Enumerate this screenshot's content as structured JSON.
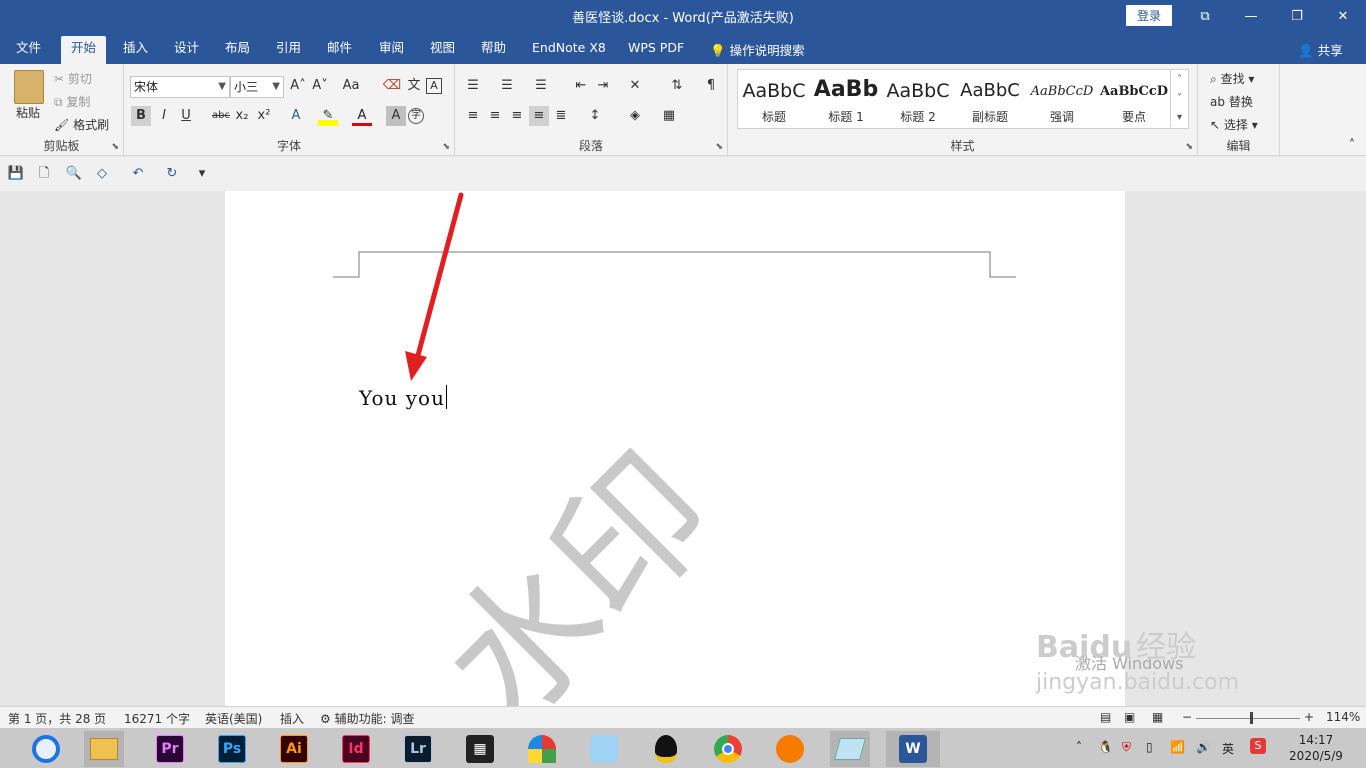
{
  "titlebar": {
    "title": "善医怪谈.docx  -  Word(产品激活失败)",
    "login": "登录",
    "restore_ribbon": "⧉",
    "minimize": "—",
    "maximize": "❐",
    "close": "✕"
  },
  "tabs": [
    "文件",
    "开始",
    "插入",
    "设计",
    "布局",
    "引用",
    "邮件",
    "审阅",
    "视图",
    "帮助",
    "EndNote X8",
    "WPS PDF"
  ],
  "active_tab": "开始",
  "tell_me": "操作说明搜索",
  "share": "共享",
  "clipboard": {
    "paste": "粘贴",
    "cut": "剪切",
    "copy": "复制",
    "format_painter": "格式刷",
    "label": "剪贴板"
  },
  "font": {
    "name": "宋体",
    "size": "小三",
    "label": "字体",
    "grow": "A˄",
    "shrink": "A˅",
    "change_case": "Aa",
    "bold": "B",
    "italic": "I",
    "underline": "U",
    "strike": "abc",
    "subscript": "x₂",
    "superscript": "x²"
  },
  "paragraph": {
    "label": "段落"
  },
  "styles": {
    "label": "样式",
    "items": [
      {
        "preview": "AaBbC",
        "name": "标题"
      },
      {
        "preview": "AaBb",
        "name": "标题 1"
      },
      {
        "preview": "AaBbC",
        "name": "标题 2"
      },
      {
        "preview": "AaBbC",
        "name": "副标题"
      },
      {
        "preview": "AaBbCcD",
        "name": "强调"
      },
      {
        "preview": "AaBbCcD",
        "name": "要点"
      }
    ]
  },
  "editing": {
    "find": "查找",
    "replace": "替换",
    "select": "选择",
    "label": "编辑"
  },
  "document": {
    "text": "You  you",
    "watermark": "水印"
  },
  "activate_windows": "激活 Windows",
  "baidu_watermark": {
    "logo": "Baidu",
    "jingyan": "经验",
    "url": "jingyan.baidu.com"
  },
  "status": {
    "page": "第 1 页，共 28 页",
    "words": "16271 个字",
    "language": "英语(美国)",
    "mode": "插入",
    "accessibility": "辅助功能: 调查",
    "zoom": "114%",
    "zoom_minus": "−",
    "zoom_plus": "+"
  },
  "taskbar": {
    "apps": [
      {
        "name": "Pr",
        "fg": "#e77bff",
        "bg": "#2a0634"
      },
      {
        "name": "Ps",
        "fg": "#31a8ff",
        "bg": "#001e36"
      },
      {
        "name": "Ai",
        "fg": "#ff9a00",
        "bg": "#330000"
      },
      {
        "name": "Id",
        "fg": "#ff3366",
        "bg": "#49021f"
      },
      {
        "name": "Lr",
        "fg": "#a7c8e0",
        "bg": "#0c1b2e"
      }
    ],
    "ime": "英",
    "time": "14:17",
    "date": "2020/5/9"
  },
  "colors": {
    "word_blue": "#2b579a",
    "arrow_red": "#e02020"
  }
}
